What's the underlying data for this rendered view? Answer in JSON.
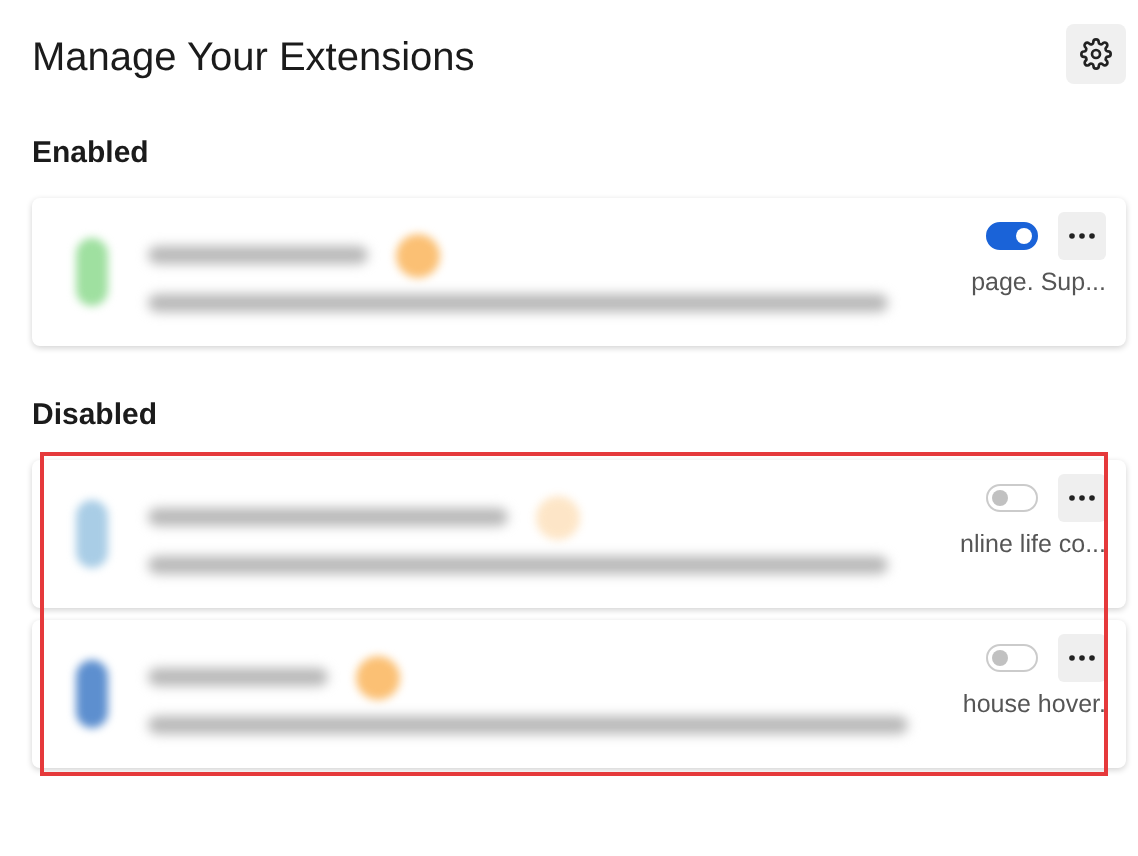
{
  "title": "Manage Your Extensions",
  "sections": [
    {
      "heading": "Enabled",
      "extensions": [
        {
          "on": true,
          "color": "#9fe0a0",
          "description_tail": "page. Sup..."
        }
      ]
    },
    {
      "heading": "Disabled",
      "highlighted": true,
      "extensions": [
        {
          "on": false,
          "color": "#a9cde6",
          "description_tail": "nline life co..."
        },
        {
          "on": false,
          "color": "#5d8fcf",
          "description_tail": "house hover."
        }
      ]
    }
  ]
}
